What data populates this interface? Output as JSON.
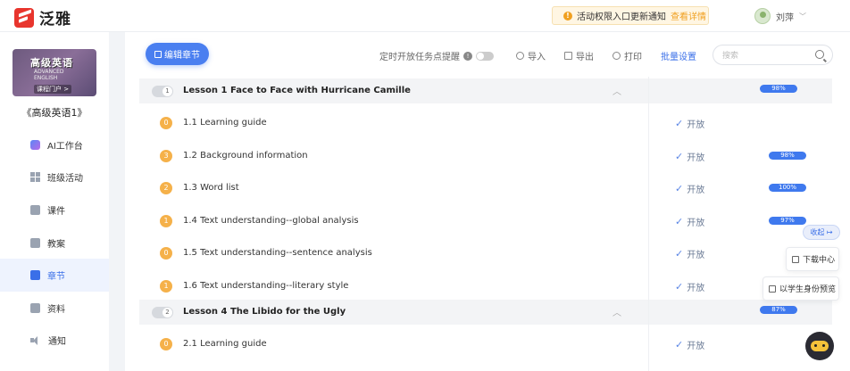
{
  "app": {
    "logo_text": "泛雅"
  },
  "notice": {
    "icon": "!",
    "text": "活动权限入口更新通知",
    "link": "查看详情"
  },
  "user": {
    "name": "刘萍"
  },
  "course": {
    "cover_title": "高级英语",
    "cover_subtitle_1": "ADVANCED",
    "cover_subtitle_2": "ENGLISH",
    "cover_portal": "课程门户 >",
    "name": "《高级英语1》"
  },
  "nav": [
    {
      "label": "AI工作台",
      "icon": "ai-icon"
    },
    {
      "label": "班级活动",
      "icon": "grid-icon"
    },
    {
      "label": "课件",
      "icon": "courseware-icon"
    },
    {
      "label": "教案",
      "icon": "lesson-plan-icon"
    },
    {
      "label": "章节",
      "icon": "chapter-icon",
      "active": true
    },
    {
      "label": "资料",
      "icon": "folder-icon"
    },
    {
      "label": "通知",
      "icon": "speaker-icon"
    }
  ],
  "toolbar": {
    "edit_label": "编辑章节",
    "timed_open_label": "定时开放任务点提醒",
    "import_label": "导入",
    "export_label": "导出",
    "print_label": "打印",
    "batch_label": "批量设置",
    "search_placeholder": "搜索"
  },
  "lessons": [
    {
      "index": "1",
      "title": "Lesson 1 Face to Face with Hurricane Camille",
      "progress": "98%",
      "sections": [
        {
          "num": "0",
          "title": "1.1 Learning guide",
          "status": "开放",
          "progress": ""
        },
        {
          "num": "3",
          "title": "1.2 Background information",
          "status": "开放",
          "progress": "98%"
        },
        {
          "num": "2",
          "title": "1.3 Word list",
          "status": "开放",
          "progress": "100%"
        },
        {
          "num": "1",
          "title": "1.4 Text understanding--global analysis",
          "status": "开放",
          "progress": "97%"
        },
        {
          "num": "0",
          "title": "1.5 Text understanding--sentence analysis",
          "status": "开放",
          "progress": ""
        },
        {
          "num": "1",
          "title": "1.6 Text understanding--literary style",
          "status": "开放",
          "progress": ""
        }
      ]
    },
    {
      "index": "2",
      "title": "Lesson 4 The Libido for the Ugly",
      "progress": "87%",
      "sections": [
        {
          "num": "0",
          "title": "2.1 Learning guide",
          "status": "开放",
          "progress": ""
        }
      ]
    }
  ],
  "float": {
    "collapse_label": "收起",
    "download_label": "下载中心",
    "preview_label": "以学生身份预览"
  },
  "colors": {
    "accent": "#3a6fe8",
    "progress": "#3f79ee",
    "badge": "#f5b14a",
    "brand": "#e8352d"
  }
}
